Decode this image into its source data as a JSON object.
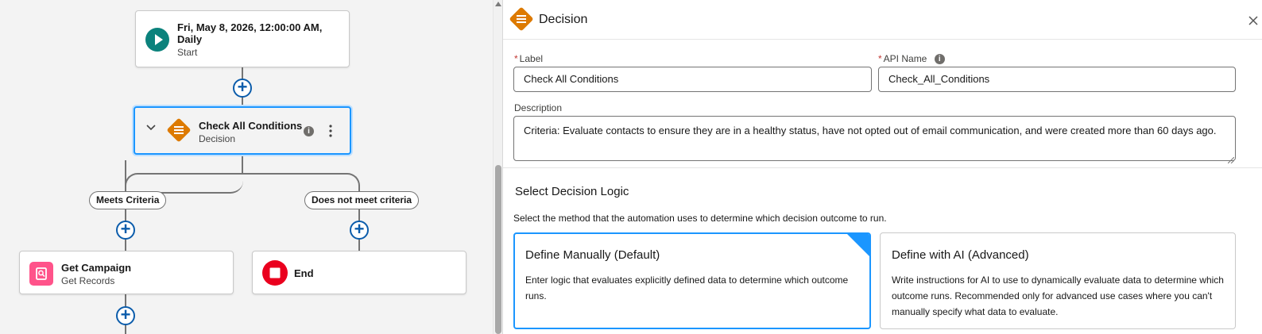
{
  "canvas": {
    "start_node": {
      "title": "Fri, May 8, 2026, 12:00:00 AM, Daily",
      "subtitle": "Start",
      "icon": "play-icon",
      "color": "#0b827c"
    },
    "decision_node": {
      "title": "Check All Conditions",
      "subtitle": "Decision",
      "icon": "decision-icon",
      "color": "#dd7a01"
    },
    "branches": [
      {
        "label": "Meets Criteria"
      },
      {
        "label": "Does not meet criteria"
      }
    ],
    "get_node": {
      "title": "Get Campaign",
      "subtitle": "Get Records",
      "icon": "get-records-icon",
      "color": "#ff538a"
    },
    "end_node": {
      "title": "End",
      "icon": "stop-icon",
      "color": "#ea001e"
    }
  },
  "panel": {
    "title": "Decision",
    "close_icon": "close-icon",
    "label_field": {
      "label": "Label",
      "value": "Check All Conditions",
      "required": "*"
    },
    "api_field": {
      "label": "API Name",
      "value": "Check_All_Conditions",
      "required": "*"
    },
    "description_field": {
      "label": "Description",
      "value": "Criteria: Evaluate contacts to ensure they are in a healthy status, have not opted out of email communication, and were created more than 60 days ago."
    },
    "logic": {
      "heading": "Select Decision Logic",
      "help": "Select the method that the automation uses to determine which decision outcome to run.",
      "options": [
        {
          "title": "Define Manually (Default)",
          "text": "Enter logic that evaluates explicitly defined data to determine which outcome runs.",
          "selected": true
        },
        {
          "title": "Define with AI (Advanced)",
          "text": "Write instructions for AI to use to dynamically evaluate data to determine which outcome runs. Recommended only for advanced use cases where you can't manually specify what data to evaluate.",
          "selected": false
        }
      ]
    }
  },
  "colors": {
    "accent": "#1b96ff",
    "brand": "#0b5cab",
    "required": "#c23934"
  }
}
